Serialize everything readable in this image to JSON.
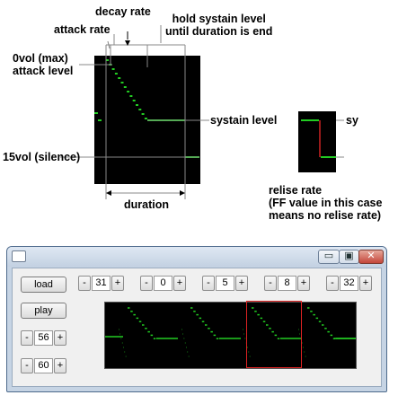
{
  "annotations": {
    "decay_rate": "decay rate",
    "hold_line1": "hold systain level",
    "hold_line2": "until duration is end",
    "attack_rate": "attack rate",
    "max_line1": "0vol (max)",
    "max_line2": "attack level",
    "systain_level": "systain level",
    "systain_level_cut": "sy",
    "silence": "15vol (silence)",
    "duration": "duration",
    "relise_line1": "relise rate",
    "relise_line2": "(FF value in this case",
    "relise_line3": "means no relise rate)"
  },
  "colors": {
    "screen": "#000000",
    "trace": "#22cc22",
    "release_marker": "#cc2222",
    "guide_line": "#888888"
  },
  "window": {
    "buttons": {
      "load": "load",
      "play": "play"
    },
    "controls": [
      {
        "minus": "-",
        "value": "31",
        "plus": "+"
      },
      {
        "minus": "-",
        "value": "0",
        "plus": "+"
      },
      {
        "minus": "-",
        "value": "5",
        "plus": "+"
      },
      {
        "minus": "-",
        "value": "8",
        "plus": "+"
      },
      {
        "minus": "-",
        "value": "32",
        "plus": "+"
      },
      {
        "minus": "-",
        "value": "56",
        "plus": "+"
      },
      {
        "minus": "-",
        "value": "60",
        "plus": "+"
      }
    ],
    "caption_buttons": {
      "minimize": "▭",
      "maximize": "▣",
      "close": "✕"
    }
  }
}
